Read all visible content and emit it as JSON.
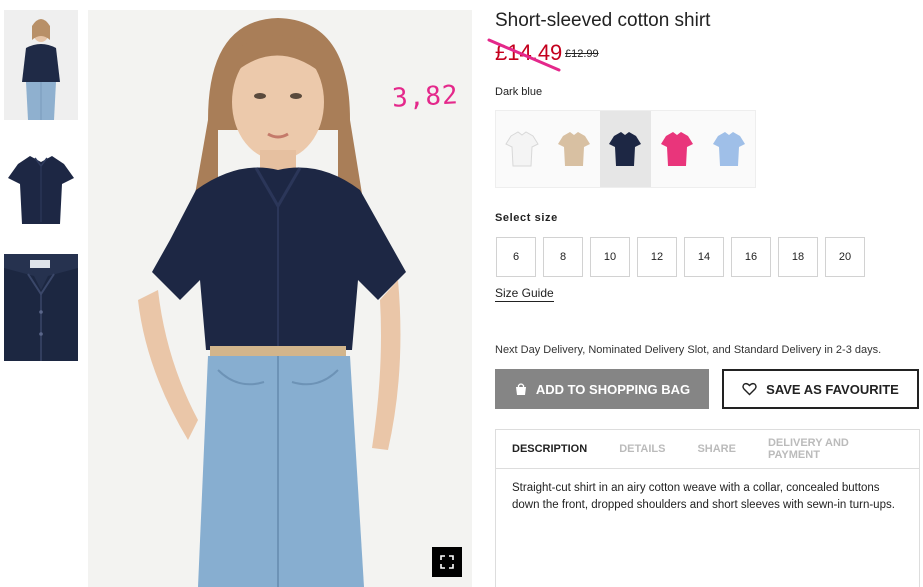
{
  "product": {
    "title": "Short-sleeved cotton shirt",
    "price": "£14.49",
    "old_price": "£12.99",
    "annotation": "3,82",
    "colors": {
      "selected_name": "Dark blue",
      "swatches": [
        {
          "name": "White",
          "hex": "#f4f4f4"
        },
        {
          "name": "Beige",
          "hex": "#d8c0a2"
        },
        {
          "name": "Dark blue",
          "hex": "#1d2744"
        },
        {
          "name": "Pink",
          "hex": "#e9357b"
        },
        {
          "name": "Light blue",
          "hex": "#9fbfe8"
        }
      ]
    },
    "size_label": "Select size",
    "sizes": [
      "6",
      "8",
      "10",
      "12",
      "14",
      "16",
      "18",
      "20"
    ],
    "size_guide": "Size Guide",
    "delivery_text": "Next Day Delivery, Nominated Delivery Slot, and Standard Delivery in 2-3 days.",
    "add_to_bag": "ADD TO SHOPPING BAG",
    "save_favourite": "SAVE AS FAVOURITE",
    "tabs": [
      "DESCRIPTION",
      "DETAILS",
      "SHARE",
      "DELIVERY AND PAYMENT"
    ],
    "description": "Straight-cut shirt in an airy cotton weave with a collar, concealed buttons down the front, dropped shoulders and short sleeves with sewn-in turn-ups."
  }
}
